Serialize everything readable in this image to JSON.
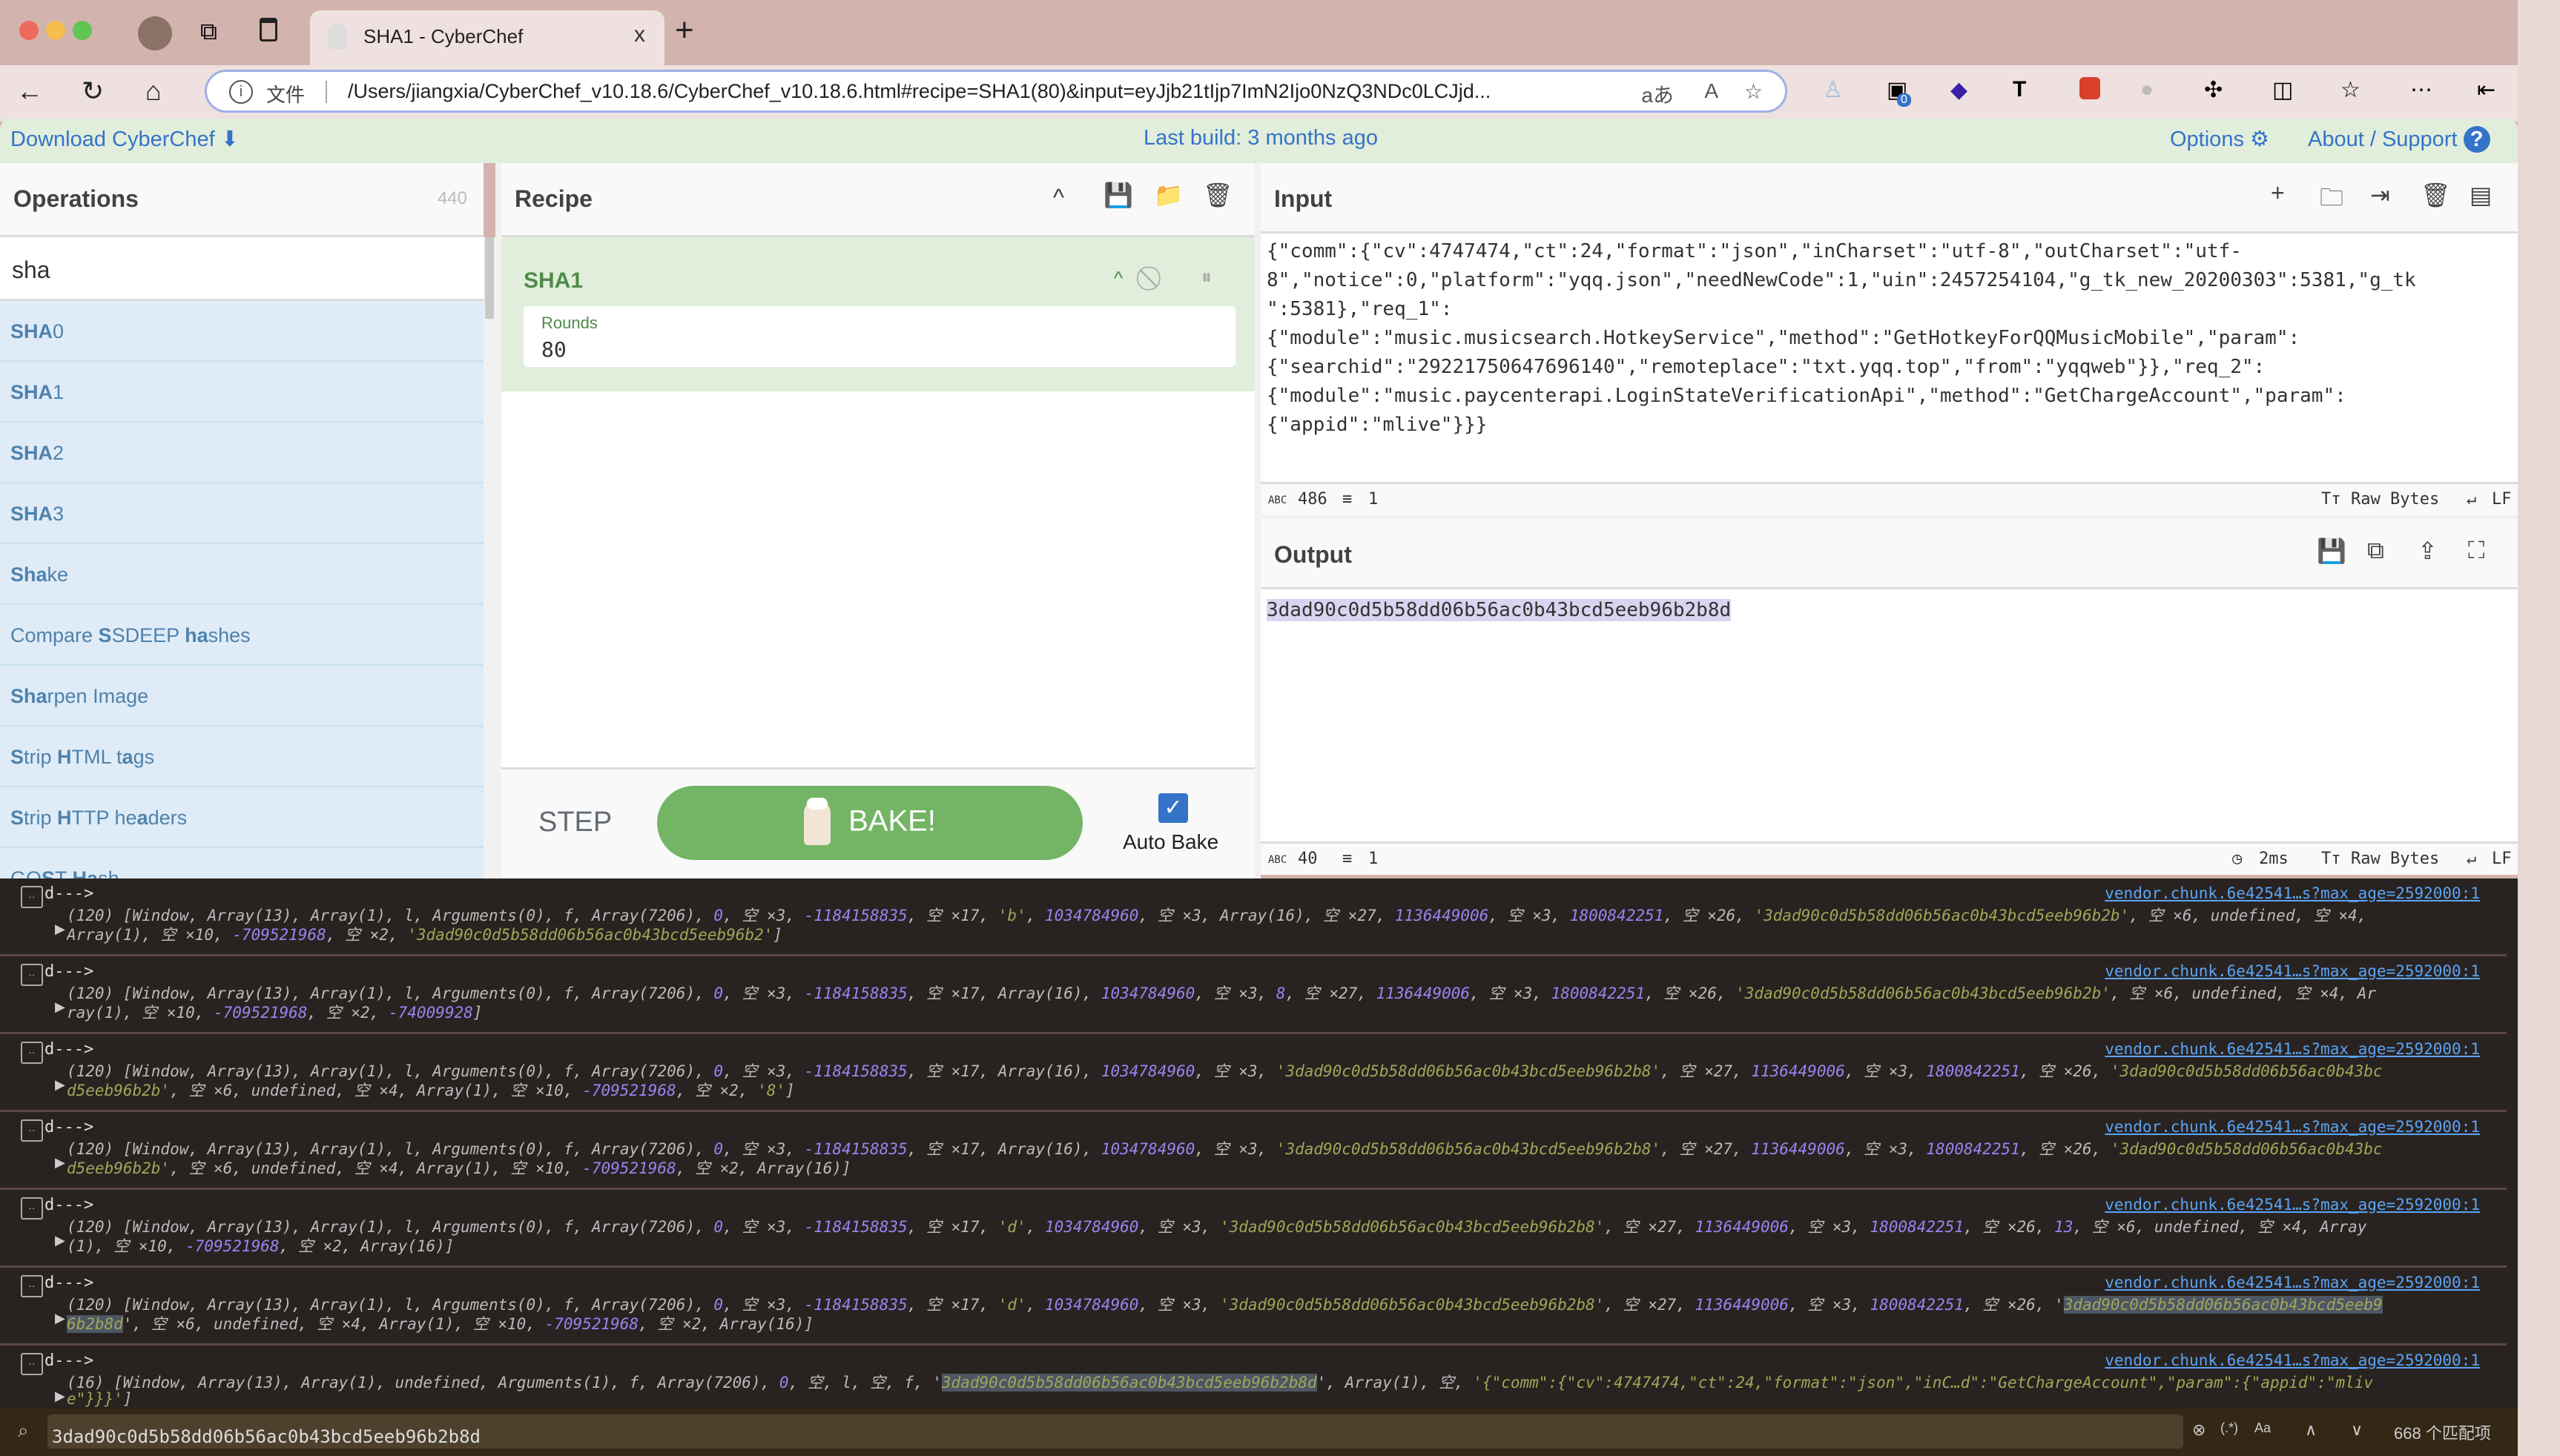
{
  "browser": {
    "tab_title": "SHA1 - CyberChef",
    "tab_close": "x",
    "new_tab": "+",
    "address_label": "文件",
    "url": "/Users/jiangxia/CyberChef_v10.18.6/CyberChef_v10.18.6.html#recipe=SHA1(80)&input=eyJjb21tIjp7ImN2Ijo0NzQ3NDc0LCJjd...",
    "extension_badge": "0"
  },
  "banner": {
    "download": "Download CyberChef",
    "last_build": "Last build: 3 months ago",
    "options": "Options",
    "about": "About / Support"
  },
  "operations": {
    "title": "Operations",
    "count": "440",
    "search_value": "sha",
    "items": [
      {
        "pre": "",
        "bold": "SHA",
        "post": "0"
      },
      {
        "pre": "",
        "bold": "SHA",
        "post": "1"
      },
      {
        "pre": "",
        "bold": "SHA",
        "post": "2"
      },
      {
        "pre": "",
        "bold": "SHA",
        "post": "3"
      },
      {
        "pre": "",
        "bold": "Sha",
        "post": "ke"
      },
      {
        "pre": "Compare ",
        "bold": "S",
        "post": "SDEEP ",
        "bold2": "ha",
        "post2": "shes"
      },
      {
        "pre": "",
        "bold": "Sha",
        "post": "rpen Image"
      },
      {
        "pre": "",
        "bold": "S",
        "post": "trip ",
        "bold2": "H",
        "post2": "TML t",
        "bold3": "a",
        "post3": "gs"
      },
      {
        "pre": "",
        "bold": "S",
        "post": "trip ",
        "bold2": "H",
        "post2": "TTP he",
        "bold3": "a",
        "post3": "ders"
      },
      {
        "pre": "GO",
        "bold": "S",
        "post": "T ",
        "bold2": "Ha",
        "post2": "sh"
      }
    ]
  },
  "recipe": {
    "title": "Recipe",
    "operation": "SHA1",
    "arg_label": "Rounds",
    "arg_value": "80",
    "step": "STEP",
    "bake": "BAKE!",
    "auto_bake": "Auto Bake",
    "auto_bake_checked": true
  },
  "input": {
    "title": "Input",
    "lines": [
      "{\"comm\":{\"cv\":4747474,\"ct\":24,\"format\":\"json\",\"inCharset\":\"utf-8\",\"outCharset\":\"utf-",
      "8\",\"notice\":0,\"platform\":\"yqq.json\",\"needNewCode\":1,\"uin\":2457254104,\"g_tk_new_20200303\":5381,\"g_tk",
      "\":5381},\"req_1\":",
      "{\"module\":\"music.musicsearch.HotkeyService\",\"method\":\"GetHotkeyForQQMusicMobile\",\"param\":",
      "{\"searchid\":\"29221750647696140\",\"remoteplace\":\"txt.yqq.top\",\"from\":\"yqqweb\"}},\"req_2\":",
      "{\"module\":\"music.paycenterapi.LoginStateVerificationApi\",\"method\":\"GetChargeAccount\",\"param\":",
      "{\"appid\":\"mlive\"}}}"
    ],
    "length": "486",
    "lines_count": "1",
    "encoding": "Raw Bytes",
    "eol": "LF"
  },
  "output": {
    "title": "Output",
    "value": "3dad90c0d5b58dd06b56ac0b43bcd5eeb96b2b8d",
    "length": "40",
    "lines_count": "1",
    "time": "2ms",
    "encoding": "Raw Bytes",
    "eol": "LF"
  },
  "console": {
    "label": "d--->",
    "source": "vendor.chunk.6e42541…s?max_age=2592000:1",
    "entries": [
      {
        "l1": [
          [
            "(120) [Window, Array(13), Array(1), l, Arguments(0), f, Array(7206), ",
            ""
          ],
          [
            "0",
            "num"
          ],
          [
            ", 空 ×3, ",
            ""
          ],
          [
            "-1184158835",
            "num"
          ],
          [
            ", 空 ×17, ",
            ""
          ],
          [
            "'b'",
            "str"
          ],
          [
            ", ",
            ""
          ],
          [
            "1034784960",
            "num"
          ],
          [
            ", 空 ×3, Array(16), 空 ×27, ",
            ""
          ],
          [
            "1136449006",
            "num"
          ],
          [
            ", 空 ×3, ",
            ""
          ],
          [
            "1800842251",
            "num"
          ],
          [
            ", 空 ×26, ",
            ""
          ],
          [
            "'3dad90c0d5b58dd06b56ac0b43bcd5eeb96b2b'",
            "str"
          ],
          [
            ", 空 ×6, undefined, 空 ×4,",
            ""
          ]
        ],
        "l2": [
          [
            "Array(1), 空 ×10, ",
            ""
          ],
          [
            "-709521968",
            "num"
          ],
          [
            ", 空 ×2, ",
            ""
          ],
          [
            "'3dad90c0d5b58dd06b56ac0b43bcd5eeb96b2'",
            "str"
          ],
          [
            "]",
            ""
          ]
        ]
      },
      {
        "l1": [
          [
            "(120) [Window, Array(13), Array(1), l, Arguments(0), f, Array(7206), ",
            ""
          ],
          [
            "0",
            "num"
          ],
          [
            ", 空 ×3, ",
            ""
          ],
          [
            "-1184158835",
            "num"
          ],
          [
            ", 空 ×17, Array(16), ",
            ""
          ],
          [
            "1034784960",
            "num"
          ],
          [
            ", 空 ×3, ",
            ""
          ],
          [
            "8",
            "num"
          ],
          [
            ", 空 ×27, ",
            ""
          ],
          [
            "1136449006",
            "num"
          ],
          [
            ", 空 ×3, ",
            ""
          ],
          [
            "1800842251",
            "num"
          ],
          [
            ", 空 ×26, ",
            ""
          ],
          [
            "'3dad90c0d5b58dd06b56ac0b43bcd5eeb96b2b'",
            "str"
          ],
          [
            ", 空 ×6, undefined, 空 ×4, Ar",
            ""
          ]
        ],
        "l2": [
          [
            "ray(1), 空 ×10, ",
            ""
          ],
          [
            "-709521968",
            "num"
          ],
          [
            ", 空 ×2, ",
            ""
          ],
          [
            "-74009928",
            "num"
          ],
          [
            "]",
            ""
          ]
        ]
      },
      {
        "l1": [
          [
            "(120) [Window, Array(13), Array(1), l, Arguments(0), f, Array(7206), ",
            ""
          ],
          [
            "0",
            "num"
          ],
          [
            ", 空 ×3, ",
            ""
          ],
          [
            "-1184158835",
            "num"
          ],
          [
            ", 空 ×17, Array(16), ",
            ""
          ],
          [
            "1034784960",
            "num"
          ],
          [
            ", 空 ×3, ",
            ""
          ],
          [
            "'3dad90c0d5b58dd06b56ac0b43bcd5eeb96b2b8'",
            "str"
          ],
          [
            ", 空 ×27, ",
            ""
          ],
          [
            "1136449006",
            "num"
          ],
          [
            ", 空 ×3, ",
            ""
          ],
          [
            "1800842251",
            "num"
          ],
          [
            ", 空 ×26, ",
            ""
          ],
          [
            "'3dad90c0d5b58dd06b56ac0b43bc",
            "str"
          ]
        ],
        "l2": [
          [
            "d5eeb96b2b'",
            "str"
          ],
          [
            ", 空 ×6, undefined, 空 ×4, Array(1), 空 ×10, ",
            ""
          ],
          [
            "-709521968",
            "num"
          ],
          [
            ", 空 ×2, ",
            ""
          ],
          [
            "'8'",
            "str"
          ],
          [
            "]",
            ""
          ]
        ]
      },
      {
        "l1": [
          [
            "(120) [Window, Array(13), Array(1), l, Arguments(0), f, Array(7206), ",
            ""
          ],
          [
            "0",
            "num"
          ],
          [
            ", 空 ×3, ",
            ""
          ],
          [
            "-1184158835",
            "num"
          ],
          [
            ", 空 ×17, Array(16), ",
            ""
          ],
          [
            "1034784960",
            "num"
          ],
          [
            ", 空 ×3, ",
            ""
          ],
          [
            "'3dad90c0d5b58dd06b56ac0b43bcd5eeb96b2b8'",
            "str"
          ],
          [
            ", 空 ×27, ",
            ""
          ],
          [
            "1136449006",
            "num"
          ],
          [
            ", 空 ×3, ",
            ""
          ],
          [
            "1800842251",
            "num"
          ],
          [
            ", 空 ×26, ",
            ""
          ],
          [
            "'3dad90c0d5b58dd06b56ac0b43bc",
            "str"
          ]
        ],
        "l2": [
          [
            "d5eeb96b2b'",
            "str"
          ],
          [
            ", 空 ×6, undefined, 空 ×4, Array(1), 空 ×10, ",
            ""
          ],
          [
            "-709521968",
            "num"
          ],
          [
            ", 空 ×2, Array(16)]",
            ""
          ]
        ]
      },
      {
        "l1": [
          [
            "(120) [Window, Array(13), Array(1), l, Arguments(0), f, Array(7206), ",
            ""
          ],
          [
            "0",
            "num"
          ],
          [
            ", 空 ×3, ",
            ""
          ],
          [
            "-1184158835",
            "num"
          ],
          [
            ", 空 ×17, ",
            ""
          ],
          [
            "'d'",
            "str"
          ],
          [
            ", ",
            ""
          ],
          [
            "1034784960",
            "num"
          ],
          [
            ", 空 ×3, ",
            ""
          ],
          [
            "'3dad90c0d5b58dd06b56ac0b43bcd5eeb96b2b8'",
            "str"
          ],
          [
            ", 空 ×27, ",
            ""
          ],
          [
            "1136449006",
            "num"
          ],
          [
            ", 空 ×3, ",
            ""
          ],
          [
            "1800842251",
            "num"
          ],
          [
            ", 空 ×26, ",
            ""
          ],
          [
            "13",
            "num"
          ],
          [
            ", 空 ×6, undefined, 空 ×4, Array",
            ""
          ]
        ],
        "l2": [
          [
            "(1), 空 ×10, ",
            ""
          ],
          [
            "-709521968",
            "num"
          ],
          [
            ", 空 ×2, Array(16)]",
            ""
          ]
        ]
      },
      {
        "l1": [
          [
            "(120) [Window, Array(13), Array(1), l, Arguments(0), f, Array(7206), ",
            ""
          ],
          [
            "0",
            "num"
          ],
          [
            ", 空 ×3, ",
            ""
          ],
          [
            "-1184158835",
            "num"
          ],
          [
            ", 空 ×17, ",
            ""
          ],
          [
            "'d'",
            "str"
          ],
          [
            ", ",
            ""
          ],
          [
            "1034784960",
            "num"
          ],
          [
            ", 空 ×3, ",
            ""
          ],
          [
            "'3dad90c0d5b58dd06b56ac0b43bcd5eeb96b2b8'",
            "str"
          ],
          [
            ", 空 ×27, ",
            ""
          ],
          [
            "1136449006",
            "num"
          ],
          [
            ", 空 ×3, ",
            ""
          ],
          [
            "1800842251",
            "num"
          ],
          [
            ", 空 ×26, '",
            ""
          ],
          [
            "3dad90c0d5b58dd06b56ac0b43bcd5eeb9",
            "str hl"
          ]
        ],
        "l2": [
          [
            "6b2b8d",
            "str hl"
          ],
          [
            "'",
            ""
          ],
          [
            ", 空 ×6, undefined, 空 ×4, Array(1), 空 ×10, ",
            ""
          ],
          [
            "-709521968",
            "num"
          ],
          [
            ", 空 ×2, Array(16)]",
            ""
          ]
        ]
      },
      {
        "l1": [
          [
            "(16) [Window, Array(13), Array(1), undefined, Arguments(1), f, Array(7206), ",
            ""
          ],
          [
            "0",
            "num"
          ],
          [
            ", 空, l, 空, f, '",
            ""
          ],
          [
            "3dad90c0d5b58dd06b56ac0b43bcd5eeb96b2b8d",
            "str hl"
          ],
          [
            "', Array(1), 空, ",
            ""
          ],
          [
            "'{\"comm\":{\"cv\":4747474,\"ct\":24,\"format\":\"json\",\"inC…d\":\"GetChargeAccount\",\"param\":{\"appid\":\"mliv",
            "str"
          ]
        ],
        "l2": [
          [
            "e\"}}}'",
            "str"
          ],
          [
            "]",
            ""
          ]
        ]
      }
    ]
  },
  "console_search": {
    "value": "3dad90c0d5b58dd06b56ac0b43bcd5eeb96b2b8d",
    "regex": "(.*)",
    "case": "Aa",
    "match_count": "668 个匹配项"
  },
  "colors": {
    "accent": "#3573c9",
    "bake_green": "#73b465",
    "recipe_green": "#4e8b48",
    "ops_bg": "#dfebf6",
    "console_bg": "#282321"
  }
}
